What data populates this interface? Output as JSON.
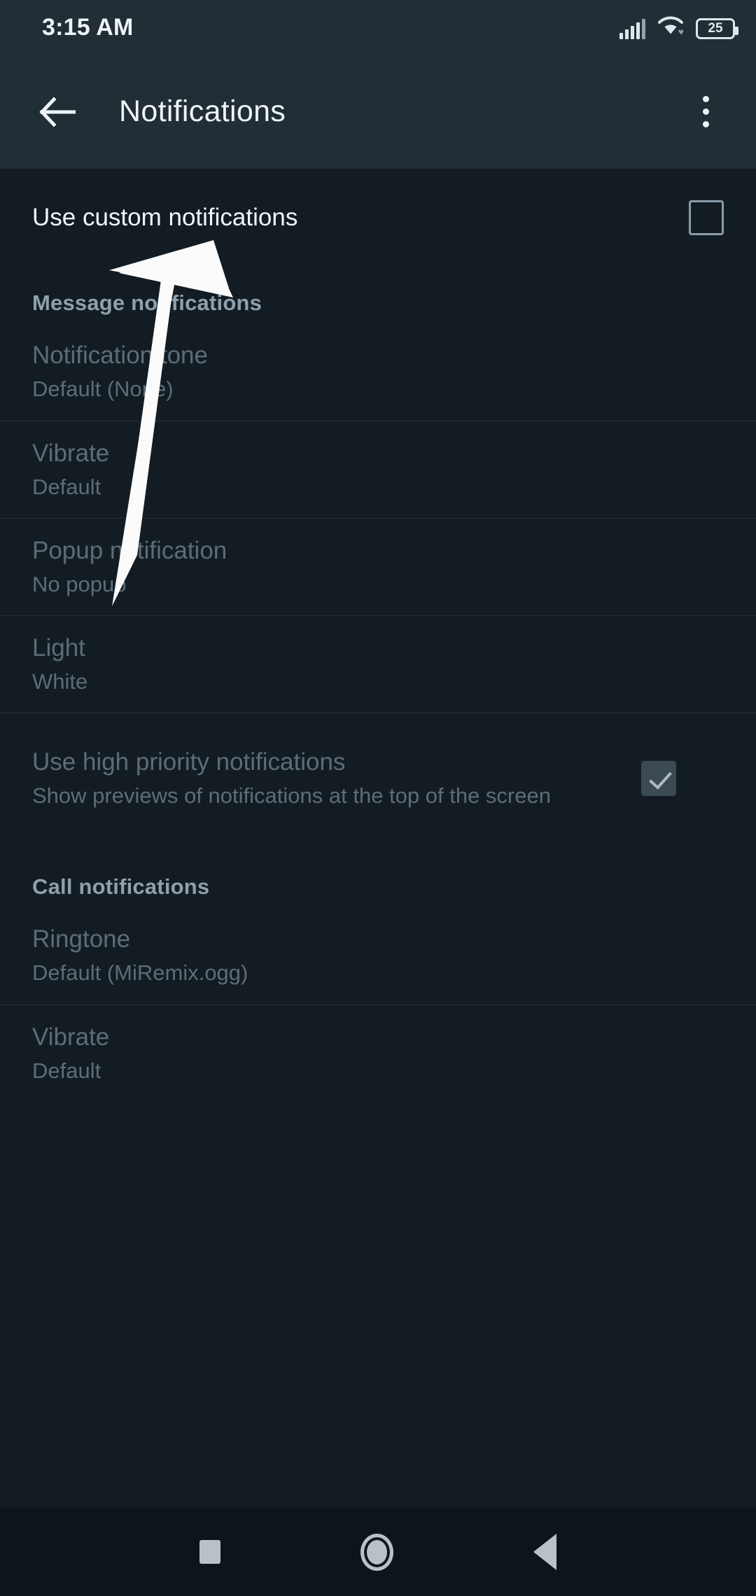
{
  "status_bar": {
    "time": "3:15 AM",
    "battery_level": "25",
    "icons": [
      "signal-icon",
      "wifi-icon",
      "battery-icon"
    ]
  },
  "app_bar": {
    "back_icon": "arrow-left-icon",
    "title": "Notifications",
    "overflow_icon": "more-vertical-icon"
  },
  "colors": {
    "app_bar_bg": "#212e36",
    "content_bg": "#131c23",
    "nav_bar_bg": "#0d141a",
    "enabled_text": "#f2f6f9",
    "disabled_text": "#5c6d78",
    "section_header": "#8ea0ac",
    "divider": "#22303a",
    "checkbox_border": "#8b9ca8",
    "annotation_arrow": "#fbfbfb"
  },
  "settings": {
    "custom_notifications": {
      "label": "Use custom notifications",
      "checked": false,
      "enabled": true
    },
    "sections": [
      {
        "header": "Message notifications",
        "items": [
          {
            "title": "Notification tone",
            "subtitle": "Default (None)",
            "enabled": false,
            "control": "none"
          },
          {
            "title": "Vibrate",
            "subtitle": "Default",
            "enabled": false,
            "control": "none"
          },
          {
            "title": "Popup notification",
            "subtitle": "No popup",
            "enabled": false,
            "control": "none"
          },
          {
            "title": "Light",
            "subtitle": "White",
            "enabled": false,
            "control": "none"
          },
          {
            "title": "Use high priority notifications",
            "subtitle": "Show previews of notifications at the top of the screen",
            "enabled": false,
            "control": "checkbox",
            "checked": true
          }
        ]
      },
      {
        "header": "Call notifications",
        "items": [
          {
            "title": "Ringtone",
            "subtitle": "Default (MiRemix.ogg)",
            "enabled": false,
            "control": "none"
          },
          {
            "title": "Vibrate",
            "subtitle": "Default",
            "enabled": false,
            "control": "none"
          }
        ]
      }
    ]
  },
  "nav_bar": {
    "recents_icon": "square-icon",
    "home_icon": "circle-icon",
    "back_icon": "triangle-left-icon"
  },
  "annotation": {
    "type": "arrow",
    "points_to": "Use custom notifications"
  }
}
